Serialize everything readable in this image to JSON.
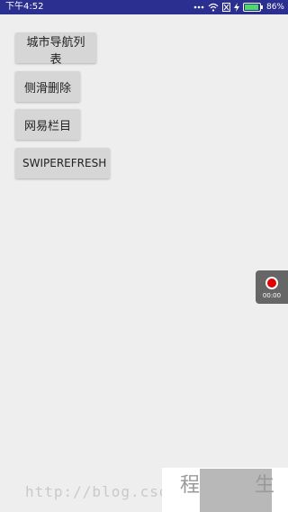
{
  "status_bar": {
    "time": "下午4:52",
    "battery_percent": "86%",
    "icons": [
      "more-dots-icon",
      "wifi-icon",
      "sim-icon",
      "charging-icon",
      "battery-icon"
    ],
    "colors": {
      "background": "#2b2f8f",
      "battery_fill": "#4cd964"
    }
  },
  "buttons": {
    "city_nav": "城市导航列表",
    "swipe_delete": "侧滑删除",
    "netease_columns": "网易栏目",
    "swipe_refresh": "SWIPEREFRESH"
  },
  "recorder": {
    "time": "00:00",
    "icon": "record-icon"
  },
  "watermark": {
    "url": "http://blog.csd",
    "text_left": "程",
    "text_right": "生"
  }
}
